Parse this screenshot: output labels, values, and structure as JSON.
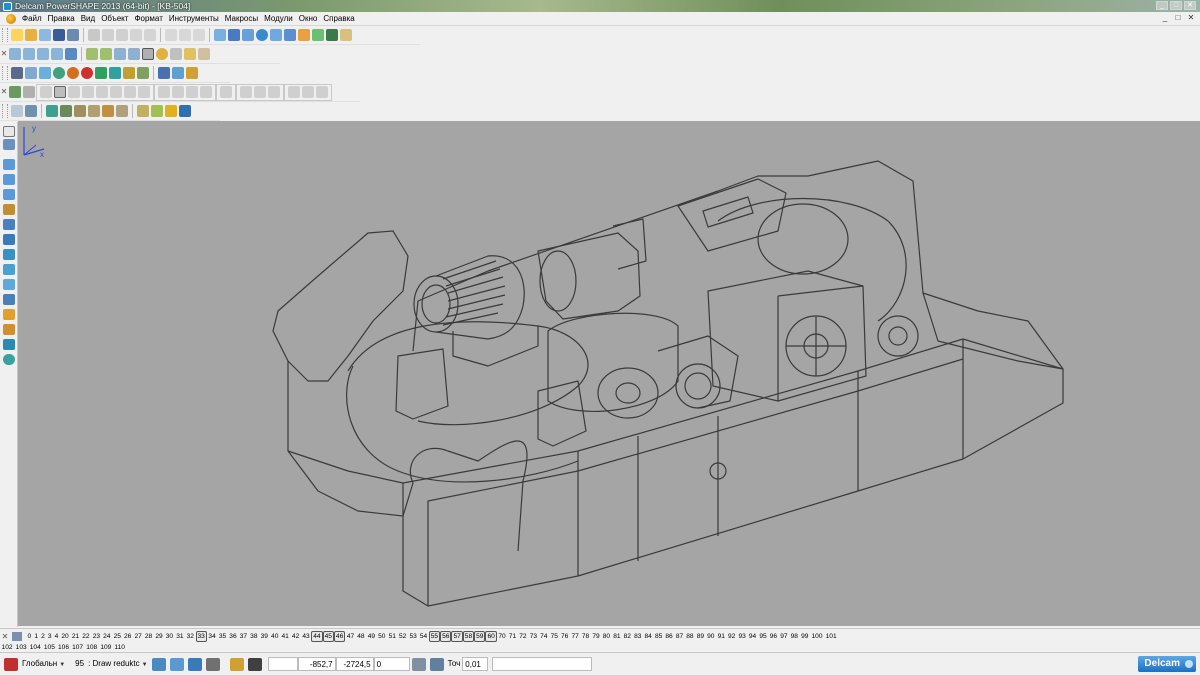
{
  "window": {
    "title": "Delcam PowerSHAPE 2013 (64-bit) - [KB-504]",
    "controls": [
      "_",
      "□",
      "✕"
    ]
  },
  "menubar": {
    "items": [
      "Файл",
      "Правка",
      "Вид",
      "Объект",
      "Формат",
      "Инструменты",
      "Макросы",
      "Модули",
      "Окно",
      "Справка"
    ],
    "mdi_controls": [
      "_",
      "□",
      "✕"
    ]
  },
  "levels": {
    "row1": [
      "0",
      "1",
      "2",
      "3",
      "4",
      "20",
      "21",
      "22",
      "23",
      "24",
      "25",
      "26",
      "27",
      "28",
      "29",
      "30",
      "31",
      "32",
      "33",
      "34",
      "35",
      "36",
      "37",
      "38",
      "39",
      "40",
      "41",
      "42",
      "43",
      "44",
      "45",
      "46",
      "47",
      "48",
      "49",
      "50",
      "51",
      "52",
      "53",
      "54",
      "55",
      "56",
      "57",
      "58",
      "59",
      "60",
      "70",
      "71",
      "72",
      "73",
      "74",
      "75",
      "76",
      "77",
      "78",
      "79",
      "80",
      "81",
      "82",
      "83",
      "84",
      "85",
      "86",
      "87",
      "88",
      "89",
      "90",
      "91",
      "92",
      "93",
      "94",
      "95",
      "96",
      "97",
      "98",
      "99",
      "100",
      "101"
    ],
    "row2": [
      "102",
      "103",
      "104",
      "105",
      "106",
      "107",
      "108",
      "109",
      "110"
    ],
    "active": [
      "33",
      "44",
      "45",
      "46",
      "55",
      "56",
      "57",
      "58",
      "59",
      "60"
    ]
  },
  "statusbar": {
    "workplane": "Глобальн",
    "level_number": "95",
    "level_name": ": Draw reduktc",
    "x": "-852,7",
    "y": "-2724,5",
    "z": "0",
    "tolerance_label": "Точ",
    "tolerance": "0,01",
    "brand": "Delcam"
  },
  "axis": {
    "x": "x",
    "y": "y"
  },
  "colors": {
    "viewport_bg": "#a5a5a5",
    "wireframe": "#3a3a3a",
    "panel_bg": "#f0f0f0"
  }
}
